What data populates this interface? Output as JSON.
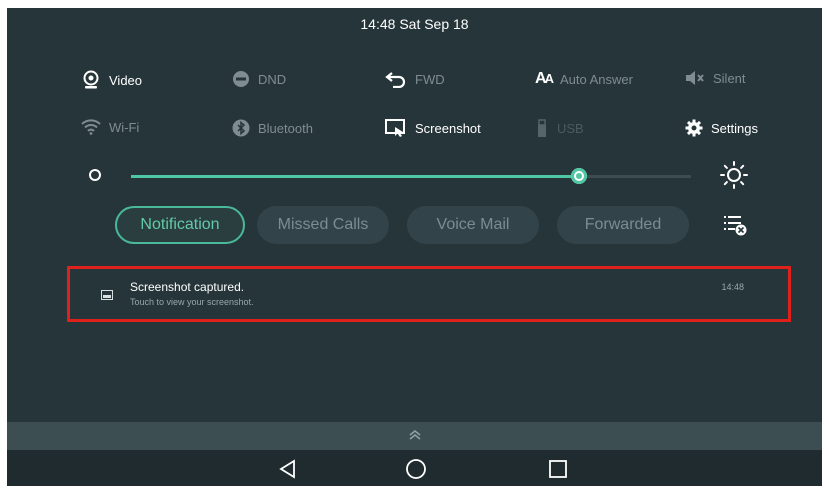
{
  "status_bar": {
    "datetime": "14:48 Sat Sep 18"
  },
  "quick_settings": {
    "row1": [
      {
        "label": "Video",
        "icon": "video-camera-icon",
        "state": "on"
      },
      {
        "label": "DND",
        "icon": "dnd-icon",
        "state": "off"
      },
      {
        "label": "FWD",
        "icon": "forward-icon",
        "state": "off"
      },
      {
        "label": "Auto Answer",
        "icon": "auto-answer-icon",
        "state": "off"
      },
      {
        "label": "Silent",
        "icon": "silent-icon",
        "state": "off"
      }
    ],
    "row2": [
      {
        "label": "Wi-Fi",
        "icon": "wifi-icon",
        "state": "off"
      },
      {
        "label": "Bluetooth",
        "icon": "bluetooth-icon",
        "state": "off"
      },
      {
        "label": "Screenshot",
        "icon": "screenshot-icon",
        "state": "on"
      },
      {
        "label": "USB",
        "icon": "usb-icon",
        "state": "off"
      },
      {
        "label": "Settings",
        "icon": "gear-icon",
        "state": "on"
      }
    ]
  },
  "brightness": {
    "level": 0.8,
    "min_icon": "brightness-low-icon",
    "max_icon": "brightness-high-icon",
    "accent": "#4fc6a4"
  },
  "tabs": [
    {
      "label": "Notification",
      "active": true
    },
    {
      "label": "Missed Calls",
      "active": false
    },
    {
      "label": "Voice Mail",
      "active": false
    },
    {
      "label": "Forwarded",
      "active": false
    }
  ],
  "clear_icon": "clear-all-icon",
  "notification": {
    "icon": "image-icon",
    "title": "Screenshot captured.",
    "subtitle": "Touch to view your screenshot.",
    "time": "14:48",
    "highlight_color": "#e0201b"
  },
  "nav": {
    "back_icon": "back-triangle-icon",
    "home_icon": "home-circle-icon",
    "recents_icon": "recents-square-icon",
    "handle_icon": "chevron-up-icon"
  }
}
